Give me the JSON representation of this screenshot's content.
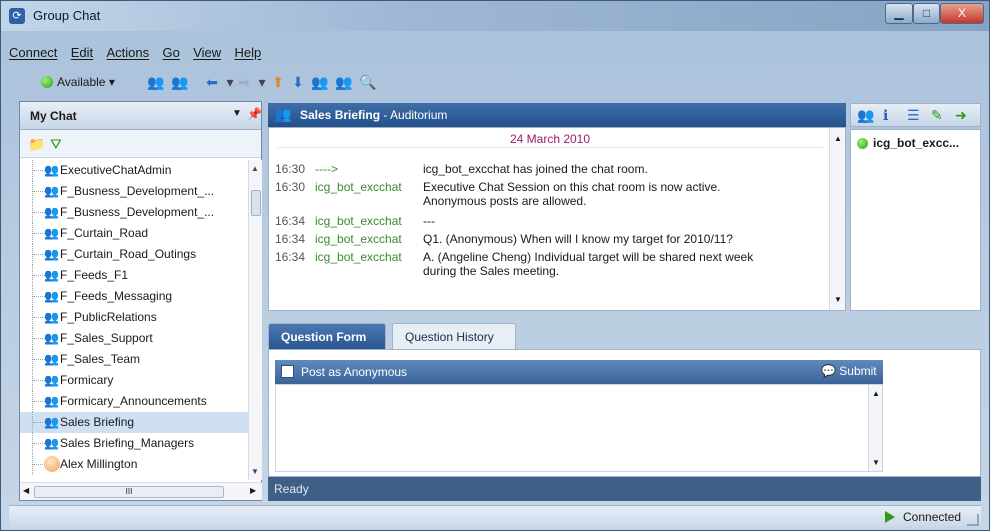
{
  "window": {
    "title": "Group Chat",
    "minimize": "▁",
    "maximize": "□",
    "close": "X"
  },
  "menu": [
    "Connect",
    "Edit",
    "Actions",
    "Go",
    "View",
    "Help"
  ],
  "toolbar": {
    "status": "Available ▾"
  },
  "left_panel": {
    "title": "My Chat",
    "rooms": [
      {
        "label": "ExecutiveChatAdmin",
        "type": "room"
      },
      {
        "label": "F_Busness_Development_...",
        "type": "room"
      },
      {
        "label": "F_Busness_Development_...",
        "type": "room"
      },
      {
        "label": "F_Curtain_Road",
        "type": "room"
      },
      {
        "label": "F_Curtain_Road_Outings",
        "type": "room"
      },
      {
        "label": "F_Feeds_F1",
        "type": "room"
      },
      {
        "label": "F_Feeds_Messaging",
        "type": "room"
      },
      {
        "label": "F_PublicRelations",
        "type": "room"
      },
      {
        "label": "F_Sales_Support",
        "type": "room"
      },
      {
        "label": "F_Sales_Team",
        "type": "room"
      },
      {
        "label": "Formicary",
        "type": "room"
      },
      {
        "label": "Formicary_Announcements",
        "type": "room"
      },
      {
        "label": "Sales Briefing",
        "type": "room",
        "selected": true
      },
      {
        "label": "Sales Briefing_Managers",
        "type": "room"
      },
      {
        "label": "Alex Millington",
        "type": "person"
      }
    ],
    "hscroll_label": "III"
  },
  "chat": {
    "room": "Sales Briefing",
    "room_suffix": " - Auditorium",
    "date": "24 March 2010",
    "messages": [
      {
        "time": "16:30",
        "who": "---->",
        "text": "icg_bot_excchat has joined the chat room."
      },
      {
        "time": "16:30",
        "who": "icg_bot_excchat",
        "text": "Executive Chat Session on this chat room is now active."
      },
      {
        "time": "",
        "who": "",
        "text": "Anonymous posts are allowed."
      },
      {
        "time": "16:34",
        "who": "icg_bot_excchat",
        "text": "---"
      },
      {
        "time": "16:34",
        "who": "icg_bot_excchat",
        "text": "Q1. (Anonymous) When will I know my target for 2010/11?"
      },
      {
        "time": "16:34",
        "who": "icg_bot_excchat",
        "text": "A. (Angeline Cheng) Individual target will be shared next week"
      },
      {
        "time": "",
        "who": "",
        "text": "during the Sales meeting."
      }
    ]
  },
  "participants": [
    {
      "name": "icg_bot_excc..."
    }
  ],
  "tabs": {
    "active": "Question Form",
    "inactive": "Question History"
  },
  "form": {
    "anonymous_label": "Post as Anonymous",
    "submit_label": "Submit"
  },
  "ready": "Ready",
  "status": {
    "connected": "Connected"
  }
}
